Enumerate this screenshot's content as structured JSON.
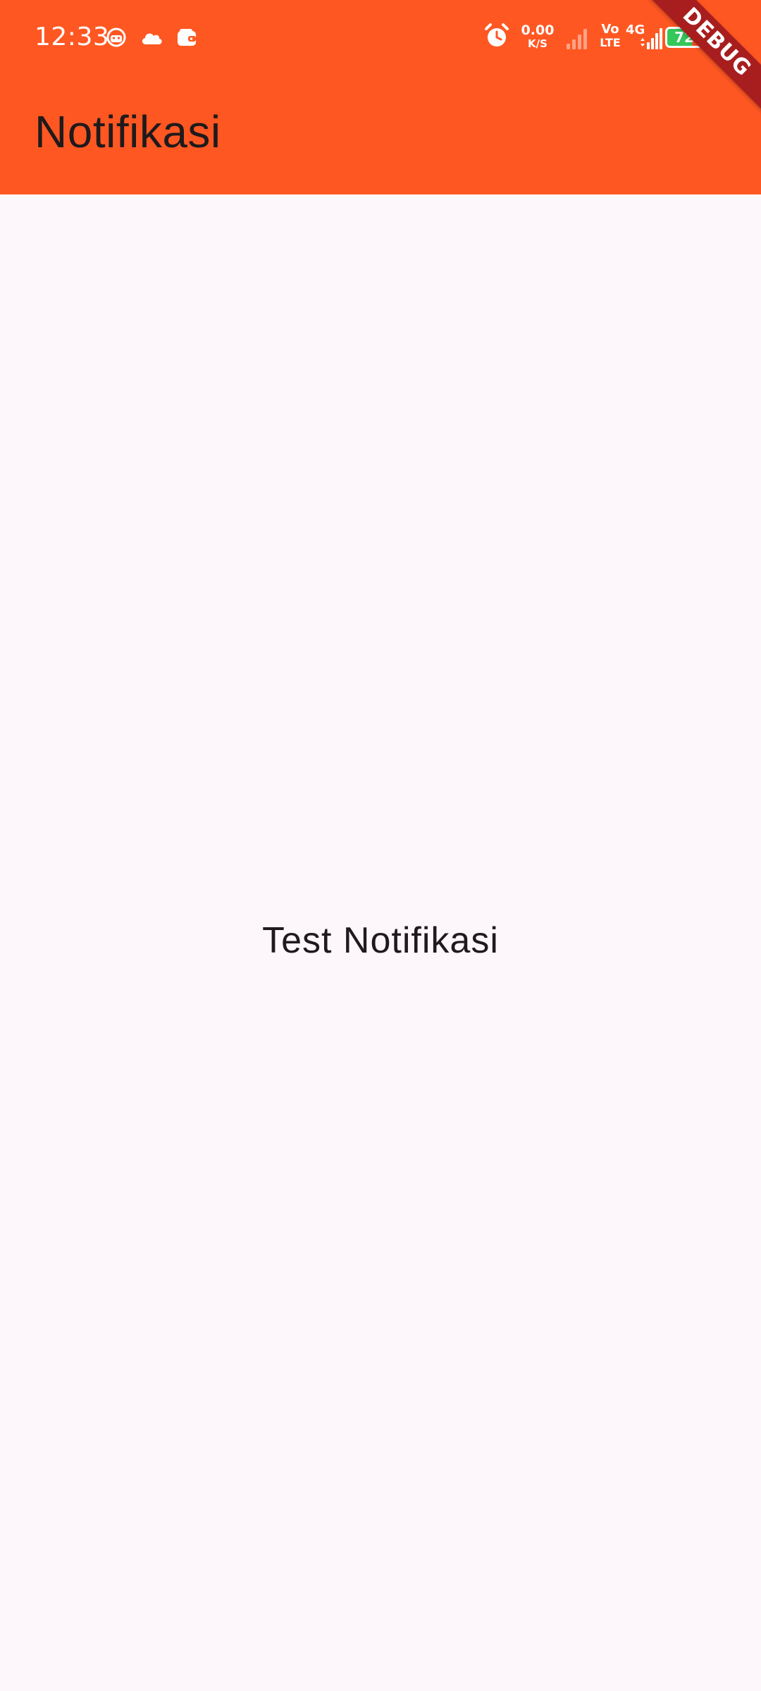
{
  "status_bar": {
    "time": "12:33",
    "left_icons": [
      "android-robot-icon",
      "cloud-icon",
      "wallet-icon"
    ],
    "net_speed_value": "0.00",
    "net_speed_unit": "K/S",
    "volte_top": "Vo",
    "volte_bottom": "LTE",
    "network_type": "4G",
    "battery_level": "72",
    "battery_fraction": 0.72,
    "battery_color": "#34c759"
  },
  "app_bar": {
    "title": "Notifikasi",
    "background_color": "#ff5722"
  },
  "body": {
    "text": "Test Notifikasi",
    "background_color": "#fdf7fc"
  },
  "debug_banner": {
    "label": "DEBUG"
  }
}
